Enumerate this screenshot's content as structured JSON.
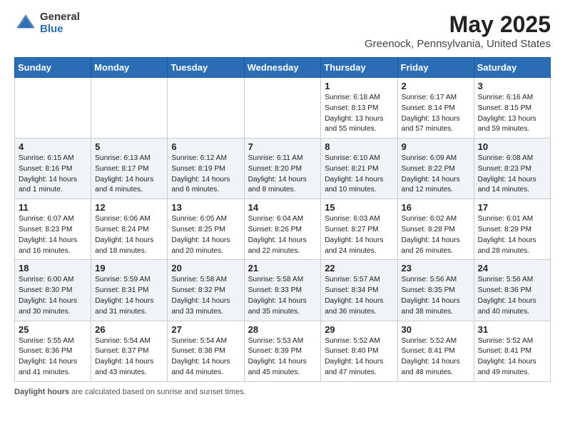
{
  "header": {
    "logo_general": "General",
    "logo_blue": "Blue",
    "month_year": "May 2025",
    "location": "Greenock, Pennsylvania, United States"
  },
  "days_of_week": [
    "Sunday",
    "Monday",
    "Tuesday",
    "Wednesday",
    "Thursday",
    "Friday",
    "Saturday"
  ],
  "weeks": [
    [
      {
        "day": "",
        "info": ""
      },
      {
        "day": "",
        "info": ""
      },
      {
        "day": "",
        "info": ""
      },
      {
        "day": "",
        "info": ""
      },
      {
        "day": "1",
        "info": "Sunrise: 6:18 AM\nSunset: 8:13 PM\nDaylight: 13 hours\nand 55 minutes."
      },
      {
        "day": "2",
        "info": "Sunrise: 6:17 AM\nSunset: 8:14 PM\nDaylight: 13 hours\nand 57 minutes."
      },
      {
        "day": "3",
        "info": "Sunrise: 6:16 AM\nSunset: 8:15 PM\nDaylight: 13 hours\nand 59 minutes."
      }
    ],
    [
      {
        "day": "4",
        "info": "Sunrise: 6:15 AM\nSunset: 8:16 PM\nDaylight: 14 hours\nand 1 minute."
      },
      {
        "day": "5",
        "info": "Sunrise: 6:13 AM\nSunset: 8:17 PM\nDaylight: 14 hours\nand 4 minutes."
      },
      {
        "day": "6",
        "info": "Sunrise: 6:12 AM\nSunset: 8:19 PM\nDaylight: 14 hours\nand 6 minutes."
      },
      {
        "day": "7",
        "info": "Sunrise: 6:11 AM\nSunset: 8:20 PM\nDaylight: 14 hours\nand 8 minutes."
      },
      {
        "day": "8",
        "info": "Sunrise: 6:10 AM\nSunset: 8:21 PM\nDaylight: 14 hours\nand 10 minutes."
      },
      {
        "day": "9",
        "info": "Sunrise: 6:09 AM\nSunset: 8:22 PM\nDaylight: 14 hours\nand 12 minutes."
      },
      {
        "day": "10",
        "info": "Sunrise: 6:08 AM\nSunset: 8:23 PM\nDaylight: 14 hours\nand 14 minutes."
      }
    ],
    [
      {
        "day": "11",
        "info": "Sunrise: 6:07 AM\nSunset: 8:23 PM\nDaylight: 14 hours\nand 16 minutes."
      },
      {
        "day": "12",
        "info": "Sunrise: 6:06 AM\nSunset: 8:24 PM\nDaylight: 14 hours\nand 18 minutes."
      },
      {
        "day": "13",
        "info": "Sunrise: 6:05 AM\nSunset: 8:25 PM\nDaylight: 14 hours\nand 20 minutes."
      },
      {
        "day": "14",
        "info": "Sunrise: 6:04 AM\nSunset: 8:26 PM\nDaylight: 14 hours\nand 22 minutes."
      },
      {
        "day": "15",
        "info": "Sunrise: 6:03 AM\nSunset: 8:27 PM\nDaylight: 14 hours\nand 24 minutes."
      },
      {
        "day": "16",
        "info": "Sunrise: 6:02 AM\nSunset: 8:28 PM\nDaylight: 14 hours\nand 26 minutes."
      },
      {
        "day": "17",
        "info": "Sunrise: 6:01 AM\nSunset: 8:29 PM\nDaylight: 14 hours\nand 28 minutes."
      }
    ],
    [
      {
        "day": "18",
        "info": "Sunrise: 6:00 AM\nSunset: 8:30 PM\nDaylight: 14 hours\nand 30 minutes."
      },
      {
        "day": "19",
        "info": "Sunrise: 5:59 AM\nSunset: 8:31 PM\nDaylight: 14 hours\nand 31 minutes."
      },
      {
        "day": "20",
        "info": "Sunrise: 5:58 AM\nSunset: 8:32 PM\nDaylight: 14 hours\nand 33 minutes."
      },
      {
        "day": "21",
        "info": "Sunrise: 5:58 AM\nSunset: 8:33 PM\nDaylight: 14 hours\nand 35 minutes."
      },
      {
        "day": "22",
        "info": "Sunrise: 5:57 AM\nSunset: 8:34 PM\nDaylight: 14 hours\nand 36 minutes."
      },
      {
        "day": "23",
        "info": "Sunrise: 5:56 AM\nSunset: 8:35 PM\nDaylight: 14 hours\nand 38 minutes."
      },
      {
        "day": "24",
        "info": "Sunrise: 5:56 AM\nSunset: 8:36 PM\nDaylight: 14 hours\nand 40 minutes."
      }
    ],
    [
      {
        "day": "25",
        "info": "Sunrise: 5:55 AM\nSunset: 8:36 PM\nDaylight: 14 hours\nand 41 minutes."
      },
      {
        "day": "26",
        "info": "Sunrise: 5:54 AM\nSunset: 8:37 PM\nDaylight: 14 hours\nand 43 minutes."
      },
      {
        "day": "27",
        "info": "Sunrise: 5:54 AM\nSunset: 8:38 PM\nDaylight: 14 hours\nand 44 minutes."
      },
      {
        "day": "28",
        "info": "Sunrise: 5:53 AM\nSunset: 8:39 PM\nDaylight: 14 hours\nand 45 minutes."
      },
      {
        "day": "29",
        "info": "Sunrise: 5:52 AM\nSunset: 8:40 PM\nDaylight: 14 hours\nand 47 minutes."
      },
      {
        "day": "30",
        "info": "Sunrise: 5:52 AM\nSunset: 8:41 PM\nDaylight: 14 hours\nand 48 minutes."
      },
      {
        "day": "31",
        "info": "Sunrise: 5:52 AM\nSunset: 8:41 PM\nDaylight: 14 hours\nand 49 minutes."
      }
    ]
  ],
  "footer": {
    "label": "Daylight hours",
    "text": " are calculated based on sunrise and sunset times."
  }
}
